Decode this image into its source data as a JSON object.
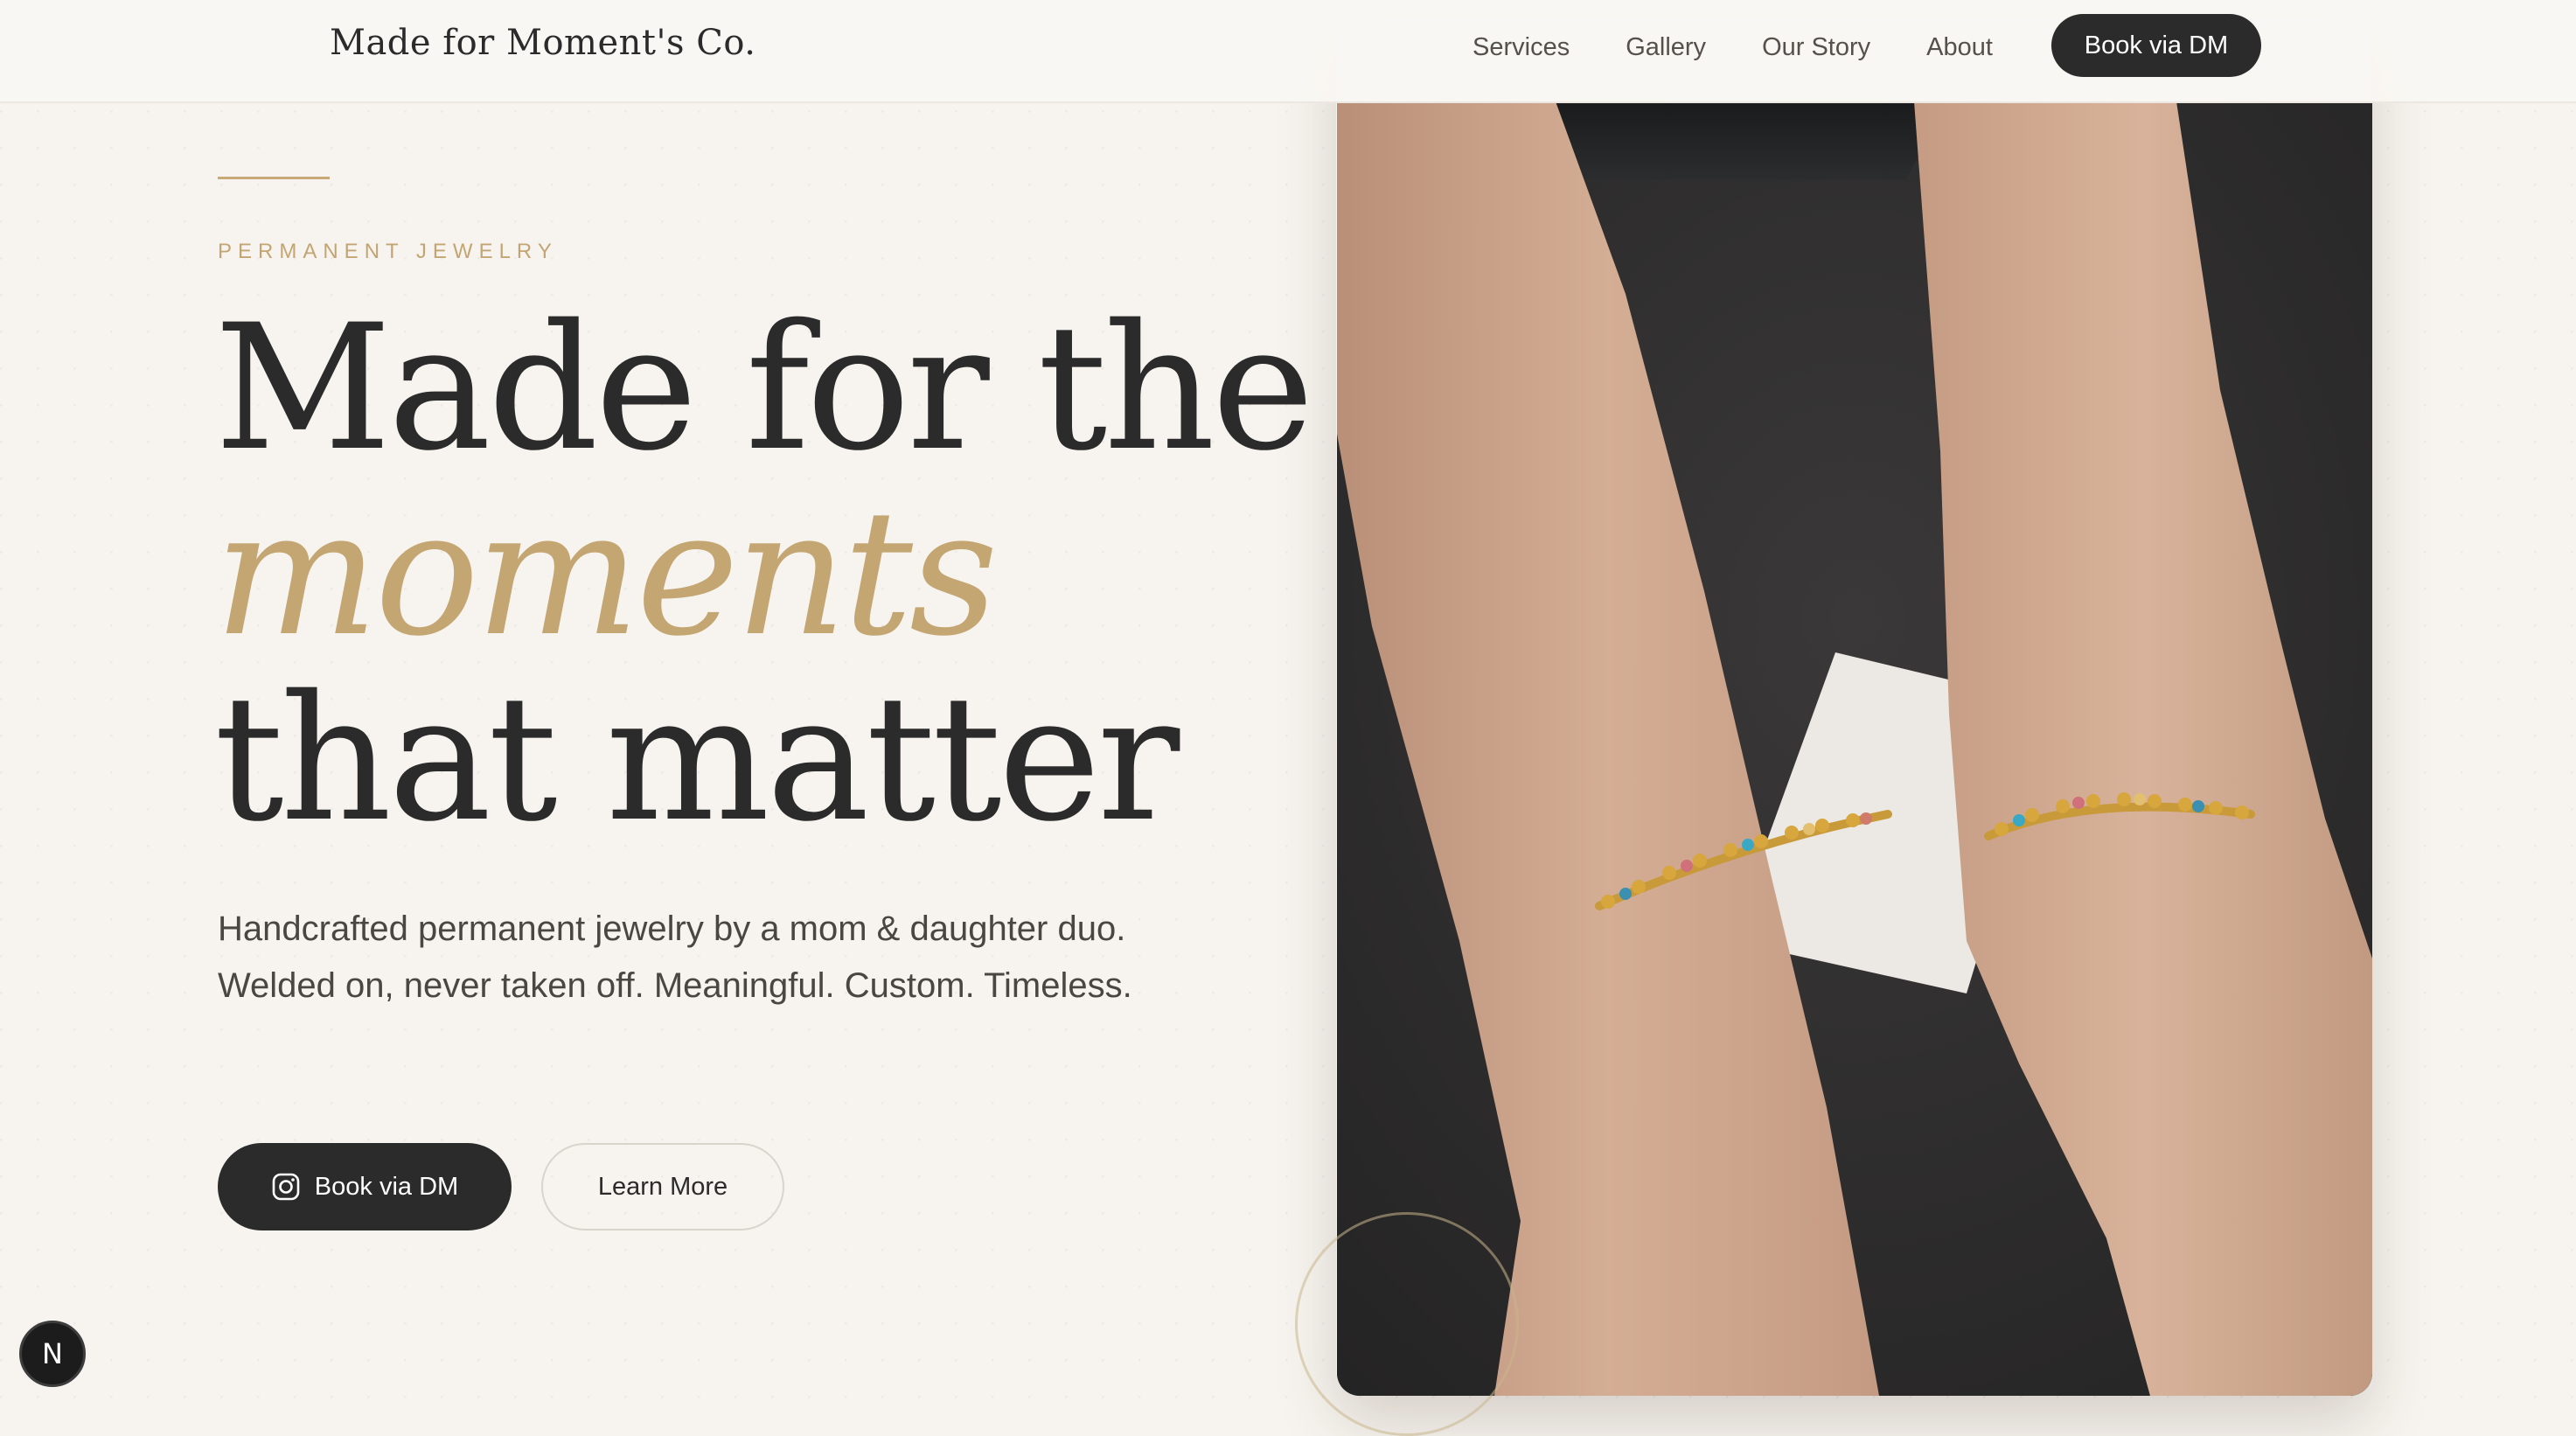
{
  "header": {
    "brand": "Made for Moment's Co.",
    "nav": [
      "Services",
      "Gallery",
      "Our Story",
      "About"
    ],
    "cta": "Book via DM"
  },
  "hero": {
    "eyebrow": "PERMANENT JEWELRY",
    "headline_line1": "Made for the",
    "headline_accent": "moments",
    "headline_line3": "that matter",
    "subtext": "Handcrafted permanent jewelry by a mom & daughter duo. Welded on, never taken off. Meaningful. Custom. Timeless.",
    "primary_button": "Book via DM",
    "secondary_button": "Learn More"
  },
  "badge": {
    "letter": "N"
  },
  "photo": {
    "subject": "Two wrists wearing matching gold beaded permanent bracelets"
  },
  "colors": {
    "accent_gold": "#c4a673",
    "dark": "#2b2b2b",
    "background": "#f7f4ef"
  },
  "icons": {
    "primary_button_icon": "instagram-icon"
  }
}
